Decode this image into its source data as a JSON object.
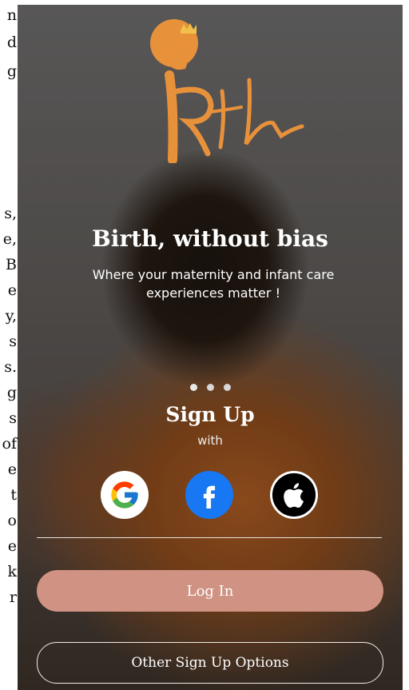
{
  "side_text": [
    "n",
    "d",
    "g",
    "s,",
    "e,",
    "B",
    "e",
    "y,",
    "s",
    "s.",
    "g",
    "s",
    "of",
    "e",
    "t",
    "o",
    "e",
    "k",
    "r"
  ],
  "logo": {
    "alt": "Rth",
    "color": "#e8913b"
  },
  "hero": {
    "title": "Birth, without bias",
    "subtitle": "Where your maternity and infant care experiences matter !"
  },
  "carousel": {
    "count": 3,
    "active": 0
  },
  "signup": {
    "title": "Sign Up",
    "with": "with"
  },
  "social": [
    {
      "name": "google",
      "icon": "google-icon"
    },
    {
      "name": "facebook",
      "icon": "facebook-icon"
    },
    {
      "name": "apple",
      "icon": "apple-icon"
    }
  ],
  "buttons": {
    "login": "Log In",
    "other": "Other Sign Up Options"
  },
  "colors": {
    "accent": "#d09282",
    "facebook": "#1877f2",
    "logo": "#e8913b"
  }
}
